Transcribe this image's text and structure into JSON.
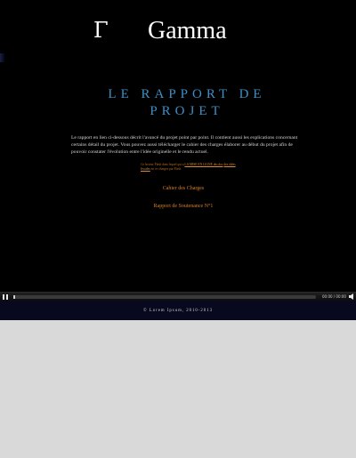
{
  "header": {
    "logo_letter": "Γ",
    "logo_word": "Gamma"
  },
  "main": {
    "title": "LE RAPPORT DE PROJET",
    "intro": "Le rapport en lien ci-dessous décrit l'avancé du projet point par point. Il contient aussi les explications concernant certains détail du projet. Vous pouvez aussi télécharger le cahier des charges élaborer au début du projet afin de pouvoir constater l'évolution entre l'idée originelle et le rendu actuel.",
    "notice_before": "Ce lecteur Flash dans lequel qui a ",
    "notice_link1": "LA MISE EN LIGNE des doc",
    "notice_link2": "des idées fiscales",
    "notice_after": " en ce chargez par Flash",
    "links": {
      "cahier_des_charges": "Cahier des Charges",
      "rapport_soutenance": "Rapport de Soutenance N°1"
    }
  },
  "player": {
    "play_symbol": "▶",
    "time": "00:00 / 00:00",
    "volume_symbol": "◀"
  },
  "footer": {
    "text": "© Lorem Ipsum, 2010-2013"
  },
  "colors": {
    "background": "#000000",
    "title": "#3e8fc6",
    "link": "#d97f22",
    "footer_band": "#08081e",
    "outside": "#d9d9d9"
  }
}
